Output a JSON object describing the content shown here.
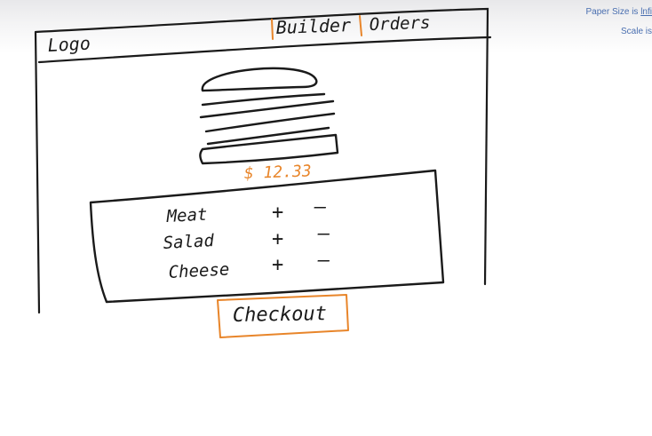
{
  "corner_notes": {
    "line1_prefix": "Paper Size is ",
    "line1_link": "lnfi",
    "line2": "Scale is"
  },
  "header": {
    "logo": "Logo",
    "nav": [
      {
        "label": "Builder",
        "active": true
      },
      {
        "label": "Orders",
        "active": false
      }
    ]
  },
  "price": "$ 12.33",
  "ingredients": [
    {
      "name": "Meat",
      "add_label": "+",
      "remove_label": "–"
    },
    {
      "name": "Salad",
      "add_label": "+",
      "remove_label": "–"
    },
    {
      "name": "Cheese",
      "add_label": "+",
      "remove_label": "–"
    }
  ],
  "checkout_label": "Checkout",
  "colors": {
    "ink": "#1a1a1a",
    "accent": "#e8852a"
  }
}
